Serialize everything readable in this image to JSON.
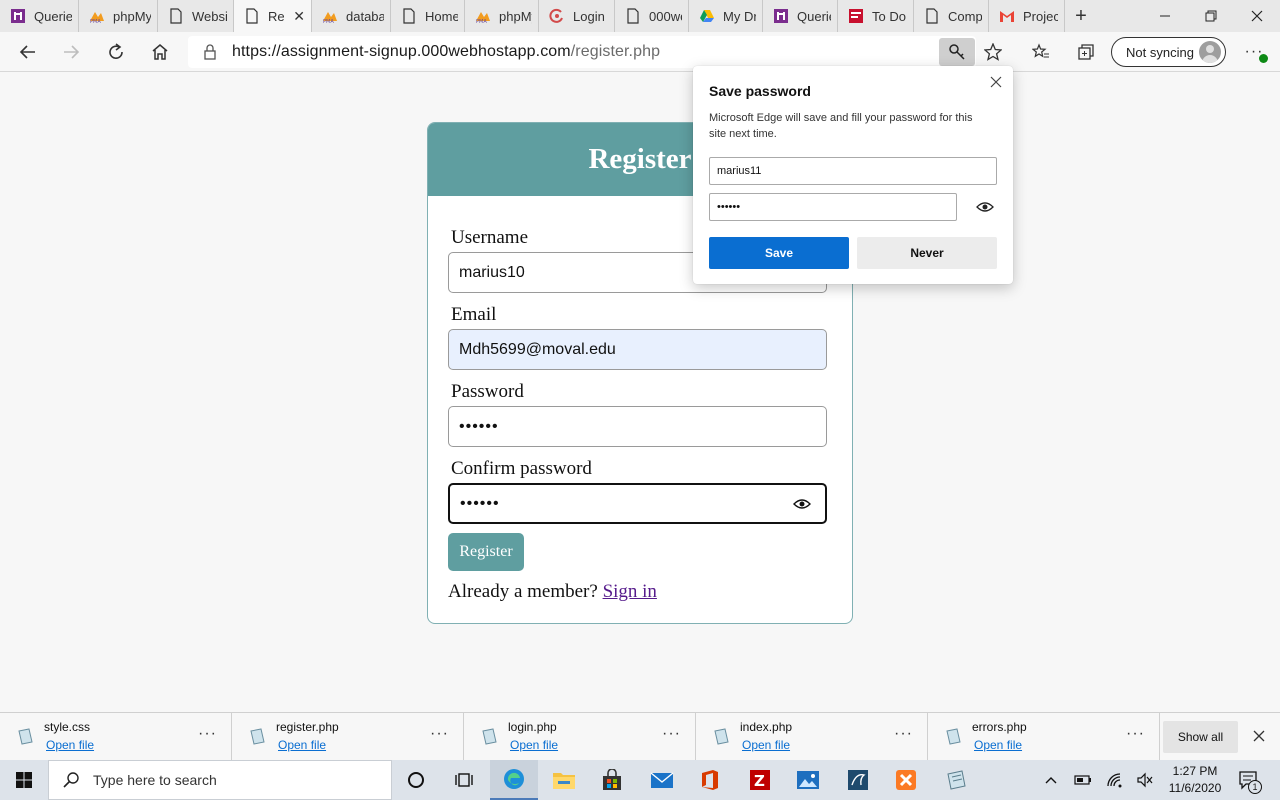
{
  "tabs": [
    {
      "label": "Querie",
      "icon": "onenote-icon"
    },
    {
      "label": "phpMy",
      "icon": "phpmyadmin-icon"
    },
    {
      "label": "Websit",
      "icon": "page-icon"
    },
    {
      "label": "Re",
      "icon": "page-icon",
      "active": true
    },
    {
      "label": "databa",
      "icon": "phpmyadmin-icon"
    },
    {
      "label": "Home",
      "icon": "page-icon"
    },
    {
      "label": "phpMy",
      "icon": "phpmyadmin-icon"
    },
    {
      "label": "Login t",
      "icon": "login-icon"
    },
    {
      "label": "000we",
      "icon": "page-icon"
    },
    {
      "label": "My Dri",
      "icon": "google-drive-icon"
    },
    {
      "label": "Querie",
      "icon": "onenote-icon"
    },
    {
      "label": "To Do",
      "icon": "todo-icon"
    },
    {
      "label": "Compl",
      "icon": "page-icon"
    },
    {
      "label": "Project",
      "icon": "gmail-icon"
    }
  ],
  "toolbar": {
    "url_host": "https://assignment-signup.000webhostapp.com",
    "url_path": "/register.php",
    "sync_label": "Not syncing"
  },
  "form": {
    "title": "Register",
    "username_label": "Username",
    "username_value": "marius10",
    "email_label": "Email",
    "email_value": "Mdh5699@moval.edu",
    "password_label": "Password",
    "password_value": "••••••",
    "confirm_label": "Confirm password",
    "confirm_value": "••••••",
    "register_button": "Register",
    "member_text": "Already a member?",
    "signin_link": "Sign in"
  },
  "popup": {
    "title": "Save password",
    "description": "Microsoft Edge will save and fill your password for this site next time.",
    "username_value": "marius11",
    "password_value": "••••••",
    "save_button": "Save",
    "never_button": "Never"
  },
  "downloads": {
    "items": [
      {
        "name": "style.css",
        "action": "Open file"
      },
      {
        "name": "register.php",
        "action": "Open file"
      },
      {
        "name": "login.php",
        "action": "Open file"
      },
      {
        "name": "index.php",
        "action": "Open file"
      },
      {
        "name": "errors.php",
        "action": "Open file"
      }
    ],
    "show_all": "Show all"
  },
  "taskbar": {
    "search_placeholder": "Type here to search",
    "time": "1:27 PM",
    "date": "11/6/2020",
    "notification_count": "1"
  }
}
